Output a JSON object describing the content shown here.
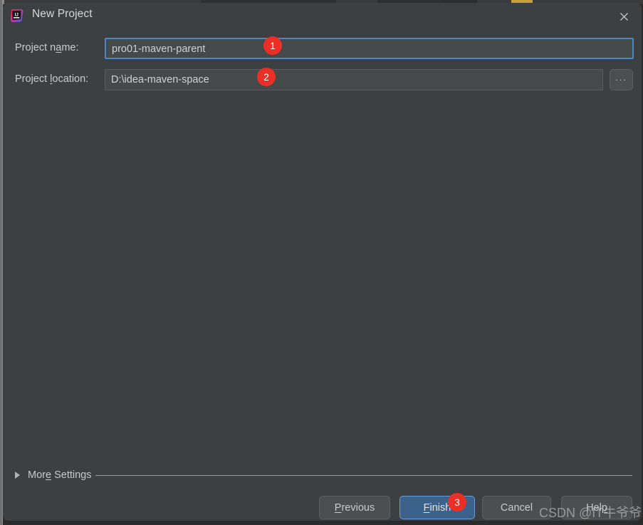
{
  "window": {
    "title": "New Project",
    "app_icon": "intellij-idea-logo-icon",
    "close_icon": "close-icon"
  },
  "form": {
    "project_name": {
      "label_prefix": "Project n",
      "label_mnemonic": "a",
      "label_suffix": "me:",
      "value": "pro01-maven-parent"
    },
    "project_location": {
      "label_prefix": "Project ",
      "label_mnemonic": "l",
      "label_suffix": "ocation:",
      "value": "D:\\idea-maven-space",
      "browse_label": "..."
    }
  },
  "more_settings": {
    "label": "More Settings",
    "label_prefix": "Mor",
    "label_mnemonic": "e",
    "label_suffix": " Settings",
    "expand_icon": "chevron-right-icon",
    "expanded": false
  },
  "footer": {
    "previous": {
      "prefix": "",
      "mnemonic": "P",
      "suffix": "revious"
    },
    "finish": {
      "prefix": "",
      "mnemonic": "F",
      "suffix": "inish"
    },
    "cancel": {
      "prefix": "Cancel",
      "mnemonic": "",
      "suffix": ""
    },
    "help": {
      "prefix": "Hel",
      "mnemonic": "p",
      "suffix": ""
    }
  },
  "annotations": [
    {
      "number": "1",
      "target": "project-name-field"
    },
    {
      "number": "2",
      "target": "project-location-field"
    },
    {
      "number": "3",
      "target": "finish-button"
    }
  ],
  "watermark": "CSDN @IT牛爷爷",
  "colors": {
    "dialog_bg": "#3c4043",
    "field_bg": "#45494a",
    "focus_border": "#4a88c7",
    "primary_button": "#3c618b",
    "badge": "#eb2f26",
    "text": "#c9cbcd"
  }
}
